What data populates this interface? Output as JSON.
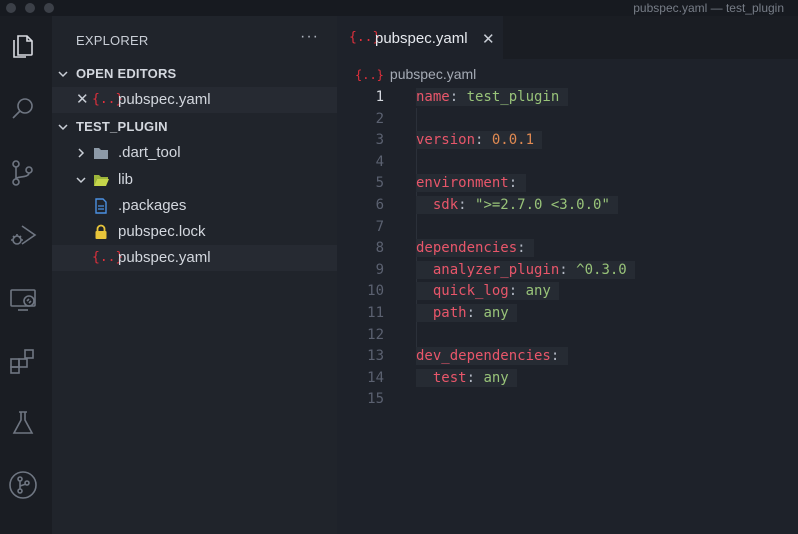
{
  "window": {
    "title": "pubspec.yaml — test_plugin"
  },
  "activity_bar": {
    "items": [
      {
        "icon": "files-icon"
      },
      {
        "icon": "search-icon"
      },
      {
        "icon": "source-control-icon"
      },
      {
        "icon": "run-debug-icon"
      },
      {
        "icon": "remote-explorer-icon"
      },
      {
        "icon": "extensions-icon"
      },
      {
        "icon": "testing-icon"
      },
      {
        "icon": "git-graph-icon"
      }
    ]
  },
  "sidebar": {
    "header": "EXPLORER",
    "more": "···",
    "open_editors": {
      "label": "OPEN EDITORS",
      "items": [
        {
          "close": "✕",
          "icon_text": "{..}",
          "name": "pubspec.yaml"
        }
      ]
    },
    "project": {
      "label": "TEST_PLUGIN",
      "items": [
        {
          "name": ".dart_tool",
          "kind": "folder-closed"
        },
        {
          "name": "lib",
          "kind": "folder-open"
        },
        {
          "name": ".packages",
          "kind": "file"
        },
        {
          "name": "pubspec.lock",
          "kind": "lock"
        },
        {
          "name": "pubspec.yaml",
          "kind": "yaml",
          "icon_text": "{..}"
        }
      ]
    }
  },
  "editor": {
    "tab": {
      "icon_text": "{..}",
      "label": "pubspec.yaml",
      "close": "✕"
    },
    "breadcrumb": {
      "icon_text": "{..}",
      "label": "pubspec.yaml"
    },
    "current_line": 1,
    "lines": [
      {
        "n": "1",
        "tokens": [
          [
            "k",
            "name"
          ],
          [
            "p",
            ": "
          ],
          [
            "s",
            "test_plugin"
          ]
        ]
      },
      {
        "n": "2",
        "tokens": []
      },
      {
        "n": "3",
        "tokens": [
          [
            "k",
            "version"
          ],
          [
            "p",
            ": "
          ],
          [
            "n",
            "0.0.1"
          ]
        ]
      },
      {
        "n": "4",
        "tokens": []
      },
      {
        "n": "5",
        "tokens": [
          [
            "k",
            "environment"
          ],
          [
            "p",
            ":"
          ]
        ]
      },
      {
        "n": "6",
        "tokens": [
          [
            "p",
            "  "
          ],
          [
            "k",
            "sdk"
          ],
          [
            "p",
            ": "
          ],
          [
            "s",
            "\">=2.7.0 <3.0.0\""
          ]
        ]
      },
      {
        "n": "7",
        "tokens": []
      },
      {
        "n": "8",
        "tokens": [
          [
            "k",
            "dependencies"
          ],
          [
            "p",
            ":"
          ]
        ]
      },
      {
        "n": "9",
        "tokens": [
          [
            "p",
            "  "
          ],
          [
            "k",
            "analyzer_plugin"
          ],
          [
            "p",
            ": "
          ],
          [
            "s",
            "^0.3.0"
          ]
        ]
      },
      {
        "n": "10",
        "tokens": [
          [
            "p",
            "  "
          ],
          [
            "k",
            "quick_log"
          ],
          [
            "p",
            ": "
          ],
          [
            "s",
            "any"
          ]
        ]
      },
      {
        "n": "11",
        "tokens": [
          [
            "p",
            "  "
          ],
          [
            "k",
            "path"
          ],
          [
            "p",
            ": "
          ],
          [
            "s",
            "any"
          ]
        ]
      },
      {
        "n": "12",
        "tokens": []
      },
      {
        "n": "13",
        "tokens": [
          [
            "k",
            "dev_dependencies"
          ],
          [
            "p",
            ":"
          ]
        ]
      },
      {
        "n": "14",
        "tokens": [
          [
            "p",
            "  "
          ],
          [
            "k",
            "test"
          ],
          [
            "p",
            ": "
          ],
          [
            "s",
            "any"
          ]
        ]
      },
      {
        "n": "15",
        "tokens": []
      }
    ]
  },
  "colors": {
    "accent_yaml": "#e0303c",
    "key": "#e8566a",
    "string": "#98c379",
    "number": "#e08a52",
    "folder": "#8d9aa8",
    "lib_folder": "#c5d64a",
    "lock": "#e8c53a",
    "file": "#4a90e2"
  }
}
